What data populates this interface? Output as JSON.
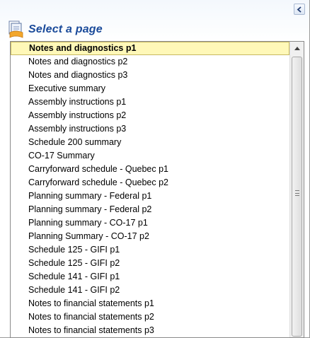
{
  "panel": {
    "title": "Select a page",
    "header_icon": "page-list-icon",
    "collapse_icon": "chevron-left-icon"
  },
  "pages": {
    "selected_index": 0,
    "items": [
      "Notes and diagnostics p1",
      "Notes and diagnostics p2",
      "Notes and diagnostics p3",
      "Executive summary",
      "Assembly instructions p1",
      "Assembly instructions p2",
      "Assembly instructions p3",
      "Schedule 200 summary",
      "CO-17 Summary",
      "Carryforward schedule - Quebec p1",
      "Carryforward schedule - Quebec p2",
      "Planning summary - Federal p1",
      "Planning summary - Federal p2",
      "Planning summary - CO-17 p1",
      "Planning Summary - CO-17 p2",
      "Schedule 125 - GIFI p1",
      "Schedule 125 - GIFI p2",
      "Schedule 141 - GIFI p1",
      "Schedule 141 - GIFI p2",
      "Notes to financial statements p1",
      "Notes to financial statements p2",
      "Notes to financial statements p3"
    ]
  },
  "colors": {
    "title": "#1a4a9a",
    "selected_background": "#fff8b8",
    "selected_border": "#c8b860"
  }
}
